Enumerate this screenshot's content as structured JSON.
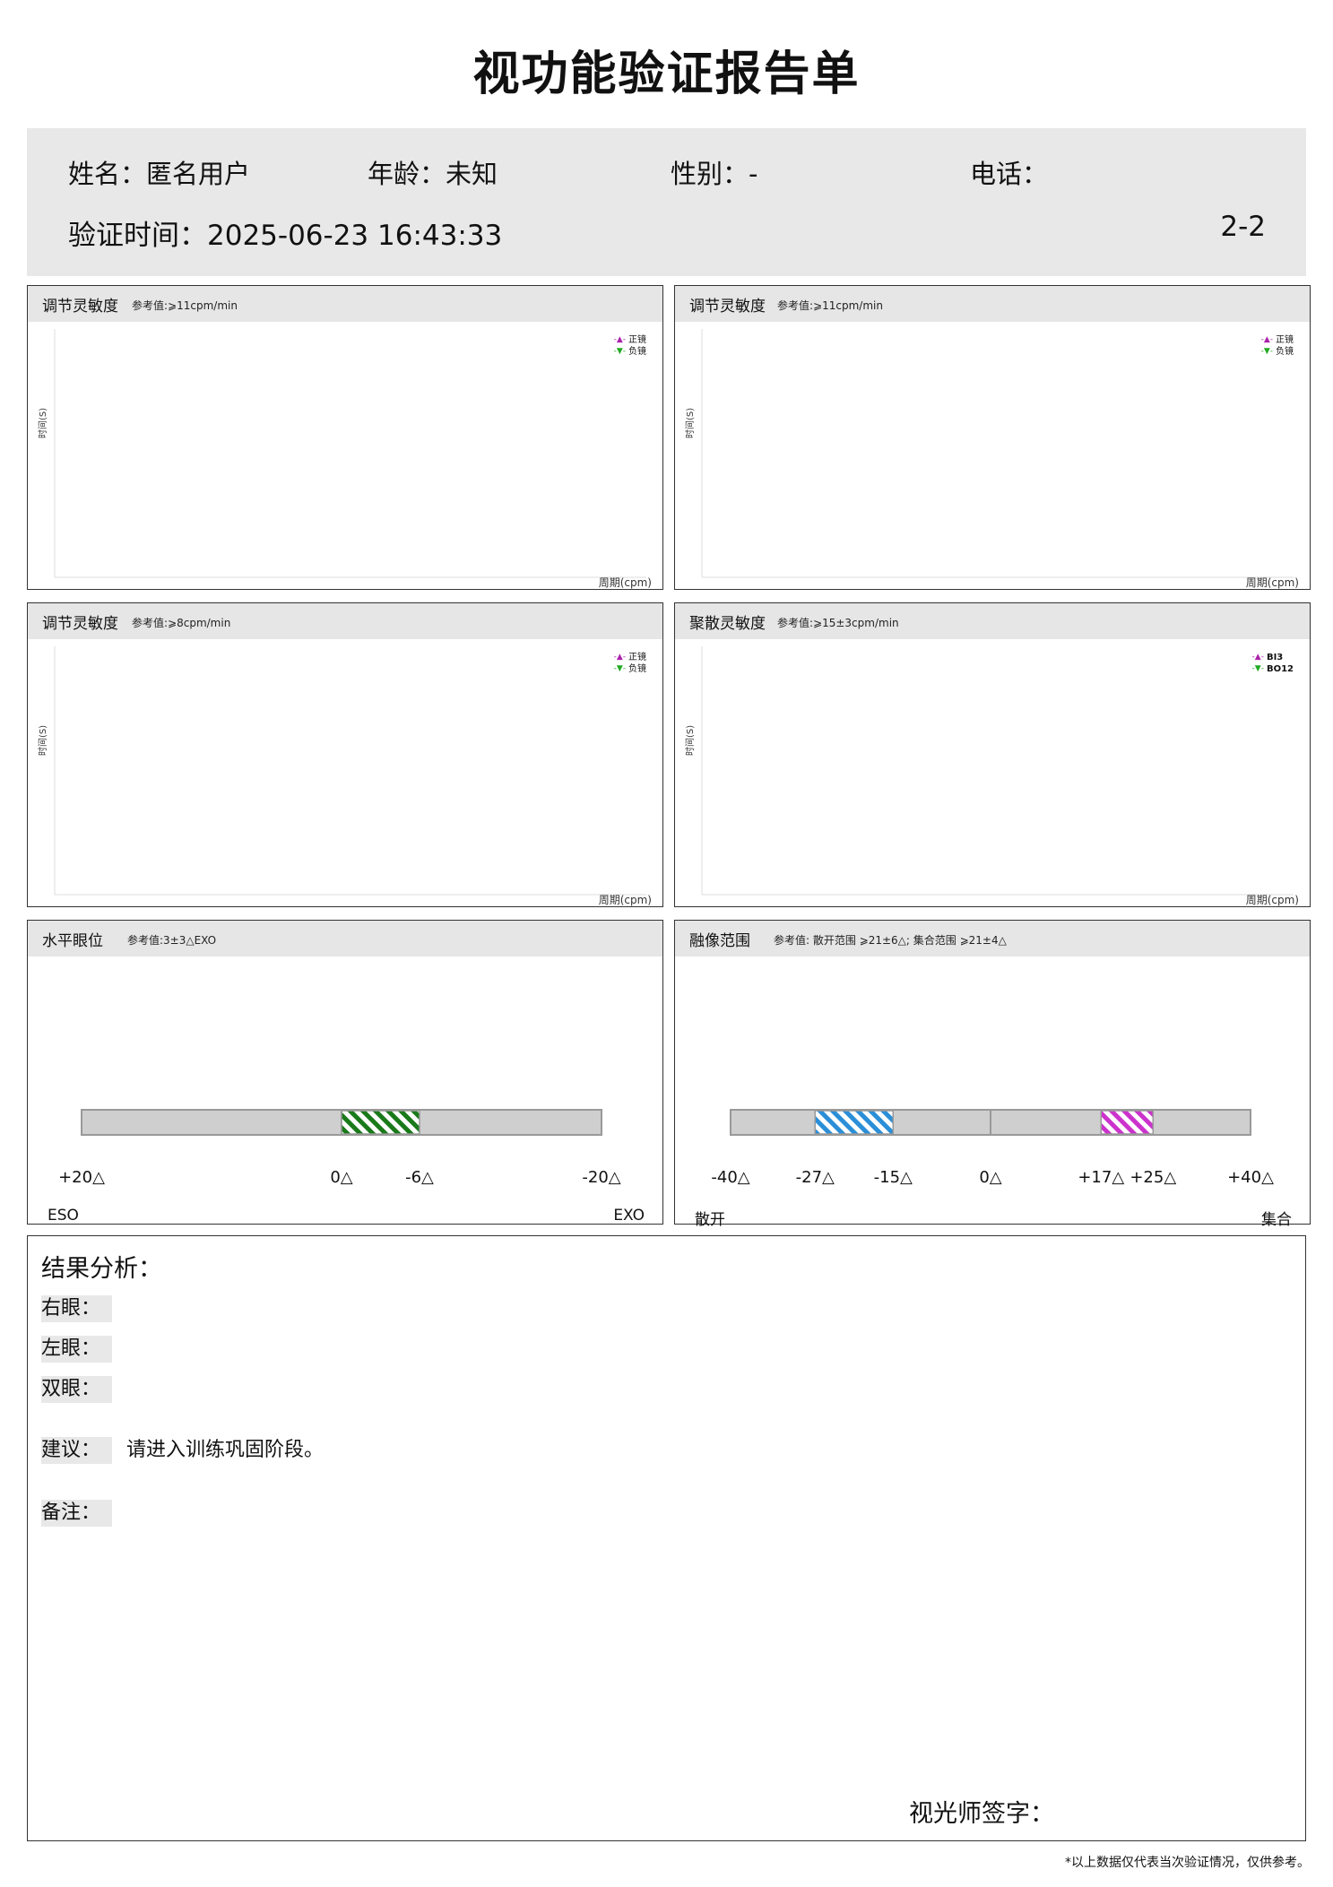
{
  "title": "视功能验证报告单",
  "info": {
    "name": "姓名：匿名用户",
    "age": "年龄：未知",
    "gender": "性别：-",
    "phone": "电话：",
    "time": "验证时间：2025-06-23 16:43:33",
    "page": "2-2"
  },
  "panels": [
    {
      "title": "调节灵敏度",
      "ref": "参考值:⩾11cpm/min",
      "ylabel": "时间(S)",
      "xlabel": "周期(cpm)",
      "legend": [
        "正镜",
        "负镜"
      ]
    },
    {
      "title": "调节灵敏度",
      "ref": "参考值:⩾11cpm/min",
      "ylabel": "时间(S)",
      "xlabel": "周期(cpm)",
      "legend": [
        "正镜",
        "负镜"
      ]
    },
    {
      "title": "调节灵敏度",
      "ref": "参考值:⩾8cpm/min",
      "ylabel": "时间(S)",
      "xlabel": "周期(cpm)",
      "legend": [
        "正镜",
        "负镜"
      ]
    },
    {
      "title": "聚散灵敏度",
      "ref": "参考值:⩾15±3cpm/min",
      "ylabel": "时间(S)",
      "xlabel": "周期(cpm)",
      "legend": [
        "BI3",
        "BO12"
      ]
    }
  ],
  "chart_data": [
    {
      "type": "line",
      "title": "调节灵敏度",
      "ylabel": "时间(S)",
      "xlabel": "周期(cpm)",
      "series": [
        {
          "name": "正镜",
          "values": []
        },
        {
          "name": "负镜",
          "values": []
        }
      ]
    },
    {
      "type": "line",
      "title": "调节灵敏度",
      "ylabel": "时间(S)",
      "xlabel": "周期(cpm)",
      "series": [
        {
          "name": "正镜",
          "values": []
        },
        {
          "name": "负镜",
          "values": []
        }
      ]
    },
    {
      "type": "line",
      "title": "调节灵敏度",
      "ylabel": "时间(S)",
      "xlabel": "周期(cpm)",
      "series": [
        {
          "name": "正镜",
          "values": []
        },
        {
          "name": "负镜",
          "values": []
        }
      ]
    },
    {
      "type": "line",
      "title": "聚散灵敏度",
      "ylabel": "时间(S)",
      "xlabel": "周期(cpm)",
      "series": [
        {
          "name": "BI3",
          "values": []
        },
        {
          "name": "BO12",
          "values": []
        }
      ]
    }
  ],
  "colors": {
    "series_a": "#aa22aa",
    "series_b": "#22aa22",
    "phoria_band": "#1a7a1a",
    "divergence_band": "#2b8fd8",
    "convergence_band": "#cc33cc",
    "bar_fill": "#cfcfcf"
  },
  "phoria": {
    "title": "水平眼位",
    "ref": "参考值:3±3△EXO",
    "axis_min": 20,
    "axis_max": -20,
    "ticks": [
      "+20△",
      "0△",
      "-6△",
      "-20△"
    ],
    "tick_values": [
      20,
      0,
      -6,
      -20
    ],
    "band": [
      0,
      -6
    ],
    "left_label": "ESO",
    "right_label": "EXO"
  },
  "fusion": {
    "title": "融像范围",
    "ref": "参考值: 散开范围 ⩾21±6△; 集合范围 ⩾21±4△",
    "axis_min": -40,
    "axis_max": 40,
    "ticks": [
      "-40△",
      "-27△",
      "-15△",
      "0△",
      "+17△",
      "+25△",
      "+40△"
    ],
    "tick_values": [
      -40,
      -27,
      -15,
      0,
      17,
      25,
      40
    ],
    "divergence_band": [
      -27,
      -15
    ],
    "convergence_band": [
      17,
      25
    ],
    "left_label": "散开",
    "right_label": "集合"
  },
  "analysis": {
    "heading": "结果分析：",
    "right_eye": "右眼：",
    "left_eye": "左眼：",
    "both_eyes": "双眼：",
    "advice_label": "建议：",
    "advice": "请进入训练巩固阶段。",
    "remark_label": "备注：",
    "signature": "视光师签字："
  },
  "footer": "*以上数据仅代表当次验证情况，仅供参考。"
}
